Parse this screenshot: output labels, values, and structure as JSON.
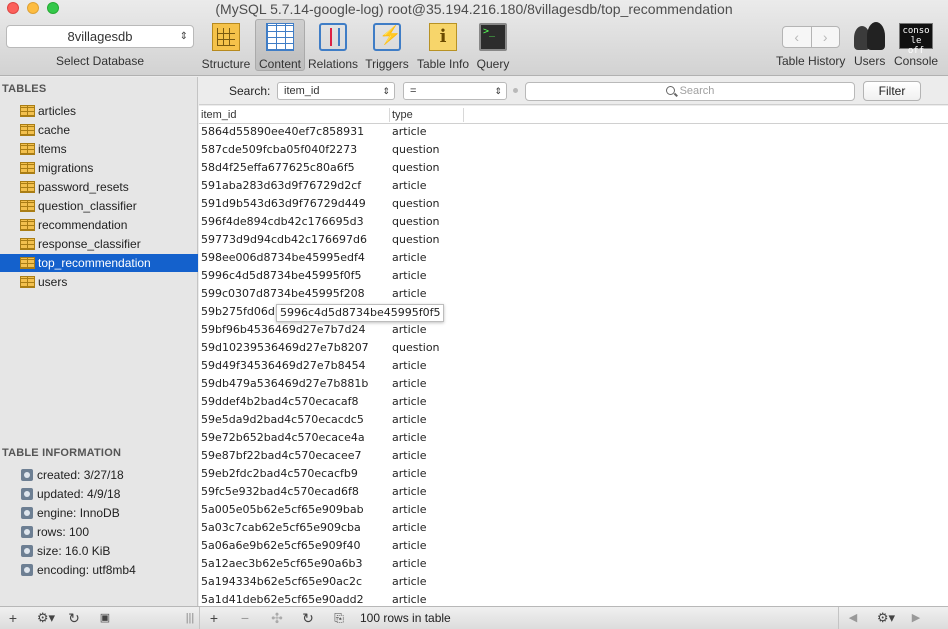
{
  "window": {
    "title": "(MySQL 5.7.14-google-log) root@35.194.216.180/8villagesdb/top_recommendation"
  },
  "database": {
    "selected": "8villagesdb",
    "caption": "Select Database"
  },
  "toolbar": {
    "tools": [
      {
        "label": "Structure",
        "icon": "structure-icon"
      },
      {
        "label": "Content",
        "icon": "content-icon"
      },
      {
        "label": "Relations",
        "icon": "relations-icon"
      },
      {
        "label": "Triggers",
        "icon": "triggers-icon"
      },
      {
        "label": "Table Info",
        "icon": "table-info-icon"
      },
      {
        "label": "Query",
        "icon": "query-icon"
      }
    ],
    "active": "Content",
    "history_label": "Table History",
    "users_label": "Users",
    "console_label": "Console",
    "console_icon_text": "conso\nle off"
  },
  "sidebar": {
    "tables_heading": "TABLES",
    "tables": [
      "articles",
      "cache",
      "items",
      "migrations",
      "password_resets",
      "question_classifier",
      "recommendation",
      "response_classifier",
      "top_recommendation",
      "users"
    ],
    "selected_table": "top_recommendation",
    "info_heading": "TABLE INFORMATION",
    "info": [
      "created: 3/27/18",
      "updated: 4/9/18",
      "engine: InnoDB",
      "rows: 100",
      "size: 16.0 KiB",
      "encoding: utf8mb4"
    ]
  },
  "filter": {
    "label": "Search:",
    "field": "item_id",
    "operator": "=",
    "search_placeholder": "Search",
    "button": "Filter"
  },
  "grid": {
    "columns": [
      "item_id",
      "type"
    ],
    "rows": [
      [
        "5864d55890ee40ef7c858931",
        "article"
      ],
      [
        "587cde509fcba05f040f2273",
        "question"
      ],
      [
        "58d4f25effa677625c80a6f5",
        "question"
      ],
      [
        "591aba283d63d9f76729d2cf",
        "article"
      ],
      [
        "591d9b543d63d9f76729d449",
        "question"
      ],
      [
        "596f4de894cdb42c176695d3",
        "question"
      ],
      [
        "59773d9d94cdb42c176697d6",
        "question"
      ],
      [
        "598ee006d8734be45995edf4",
        "article"
      ],
      [
        "5996c4d5d8734be45995f0f5",
        "article"
      ],
      [
        "599c0307d8734be45995f208",
        "article"
      ],
      [
        "59b275fd06d",
        "article"
      ],
      [
        "59bf96b4536469d27e7b7d24",
        "article"
      ],
      [
        "59d10239536469d27e7b8207",
        "question"
      ],
      [
        "59d49f34536469d27e7b8454",
        "article"
      ],
      [
        "59db479a536469d27e7b881b",
        "article"
      ],
      [
        "59ddef4b2bad4c570ecacaf8",
        "article"
      ],
      [
        "59e5da9d2bad4c570ecacdc5",
        "article"
      ],
      [
        "59e72b652bad4c570ecace4a",
        "article"
      ],
      [
        "59e87bf22bad4c570ecacee7",
        "article"
      ],
      [
        "59eb2fdc2bad4c570ecacfb9",
        "article"
      ],
      [
        "59fc5e932bad4c570ecad6f8",
        "article"
      ],
      [
        "5a005e05b62e5cf65e909bab",
        "article"
      ],
      [
        "5a03c7cab62e5cf65e909cba",
        "article"
      ],
      [
        "5a06a6e9b62e5cf65e909f40",
        "article"
      ],
      [
        "5a12aec3b62e5cf65e90a6b3",
        "article"
      ],
      [
        "5a194334b62e5cf65e90ac2c",
        "article"
      ],
      [
        "5a1d41deb62e5cf65e90add2",
        "article"
      ]
    ],
    "tooltip": "5996c4d5d8734be45995f0f5"
  },
  "statusbar": {
    "rows_text": "100 rows in table"
  }
}
